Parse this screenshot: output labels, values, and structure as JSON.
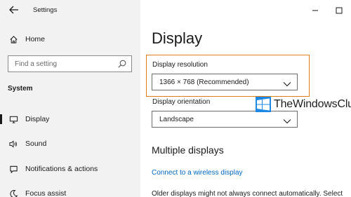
{
  "window": {
    "title": "Settings",
    "back_icon": "back-arrow-icon",
    "minimize_icon": "minimize-icon",
    "maximize_icon": "maximize-icon"
  },
  "sidebar": {
    "home_label": "Home",
    "search_placeholder": "Find a setting",
    "section_label": "System",
    "items": [
      {
        "label": "Display",
        "icon": "monitor-icon",
        "selected": true
      },
      {
        "label": "Sound",
        "icon": "speaker-icon",
        "selected": false
      },
      {
        "label": "Notifications & actions",
        "icon": "notification-icon",
        "selected": false
      },
      {
        "label": "Focus assist",
        "icon": "moon-icon",
        "selected": false
      }
    ]
  },
  "main": {
    "title": "Display",
    "resolution_label": "Display resolution",
    "resolution_value": "1366 × 768 (Recommended)",
    "orientation_label": "Display orientation",
    "orientation_value": "Landscape",
    "multiple_heading": "Multiple displays",
    "connect_link": "Connect to a wireless display",
    "older_text": "Older displays might not always connect automatically. Select"
  },
  "watermark": {
    "text": "TheWindowsClub"
  },
  "colors": {
    "sidebar_bg": "#f2f2f2",
    "highlight": "#e07d1a",
    "link": "#0067c0"
  }
}
